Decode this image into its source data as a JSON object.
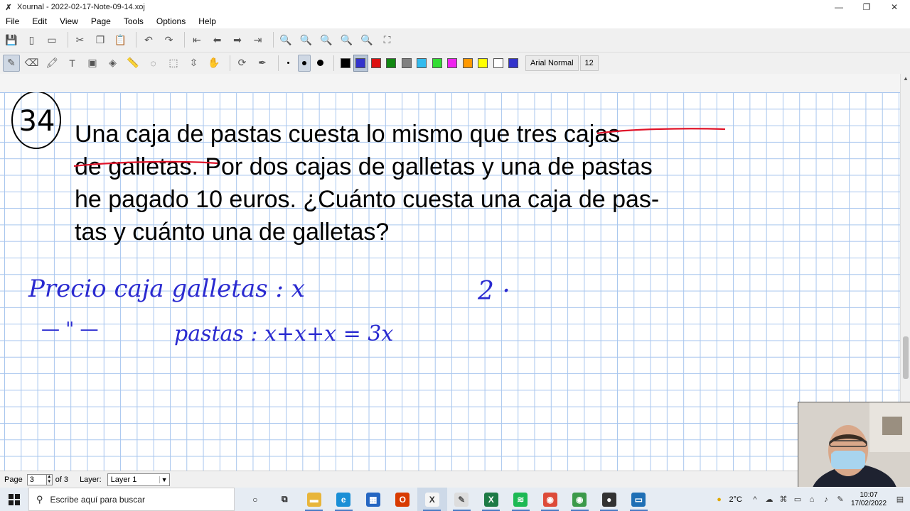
{
  "window": {
    "title": "Xournal - 2022-02-17-Note-09-14.xoj"
  },
  "menu": [
    "File",
    "Edit",
    "View",
    "Page",
    "Tools",
    "Options",
    "Help"
  ],
  "toolbar_main": [
    {
      "name": "save-icon",
      "glyph": "💾"
    },
    {
      "name": "new-page-icon",
      "glyph": "▯"
    },
    {
      "name": "open-icon",
      "glyph": "▭"
    },
    {
      "name": "cut-icon",
      "glyph": "✂"
    },
    {
      "name": "copy-icon",
      "glyph": "❐"
    },
    {
      "name": "paste-icon",
      "glyph": "📋"
    },
    {
      "name": "undo-icon",
      "glyph": "↶"
    },
    {
      "name": "redo-icon",
      "glyph": "↷"
    },
    {
      "name": "first-page-icon",
      "glyph": "⇤"
    },
    {
      "name": "previous-page-icon",
      "glyph": "⬅"
    },
    {
      "name": "next-page-icon",
      "glyph": "➡"
    },
    {
      "name": "last-page-icon",
      "glyph": "⇥"
    },
    {
      "name": "zoom-out-icon",
      "glyph": "🔍"
    },
    {
      "name": "zoom-normal-icon",
      "glyph": "🔍"
    },
    {
      "name": "zoom-in-icon",
      "glyph": "🔍"
    },
    {
      "name": "zoom-page-width-icon",
      "glyph": "🔍"
    },
    {
      "name": "zoom-set-icon",
      "glyph": "🔍"
    },
    {
      "name": "fullscreen-icon",
      "glyph": "⛶"
    }
  ],
  "toolbar_tools": [
    {
      "name": "pen-icon",
      "glyph": "✎",
      "active": true
    },
    {
      "name": "eraser-icon",
      "glyph": "⌫"
    },
    {
      "name": "highlighter-icon",
      "glyph": "🖍"
    },
    {
      "name": "text-icon",
      "glyph": "T"
    },
    {
      "name": "insert-image-icon",
      "glyph": "▣"
    },
    {
      "name": "shape-recognizer-icon",
      "glyph": "◈"
    },
    {
      "name": "ruler-icon",
      "glyph": "📏"
    },
    {
      "name": "select-region-icon",
      "glyph": "◌"
    },
    {
      "name": "select-rectangle-icon",
      "glyph": "⬚"
    },
    {
      "name": "vertical-space-icon",
      "glyph": "⇳"
    },
    {
      "name": "hand-icon",
      "glyph": "✋"
    },
    {
      "name": "default-tools-icon",
      "glyph": "⟳"
    },
    {
      "name": "default-pen-icon",
      "glyph": "✒"
    }
  ],
  "pen_sizes": [
    "fine-dot-icon",
    "medium-dot-icon",
    "thick-dot-icon"
  ],
  "palette": [
    {
      "name": "color-black",
      "color": "#000000"
    },
    {
      "name": "color-blue",
      "color": "#3333cc",
      "active": true
    },
    {
      "name": "color-red",
      "color": "#dd1111"
    },
    {
      "name": "color-green",
      "color": "#118811"
    },
    {
      "name": "color-gray",
      "color": "#808080"
    },
    {
      "name": "color-light-blue",
      "color": "#33bbee"
    },
    {
      "name": "color-light-green",
      "color": "#33dd33"
    },
    {
      "name": "color-magenta",
      "color": "#ee22ee"
    },
    {
      "name": "color-orange",
      "color": "#ff9900"
    },
    {
      "name": "color-yellow",
      "color": "#ffff00"
    },
    {
      "name": "color-white",
      "color": "#ffffff"
    },
    {
      "name": "color-custom-blue",
      "color": "#3333cc"
    }
  ],
  "font": {
    "name": "Arial Normal",
    "size": "12"
  },
  "problem": {
    "number": "34",
    "lines": [
      "Una caja de pastas cuesta lo mismo que tres cajas",
      "de galletas. Por dos cajas de galletas y una de pastas",
      "he pagado 10 euros. ¿Cuánto cuesta una caja de pas-",
      "tas y cuánto una de galletas?"
    ]
  },
  "handwriting": {
    "line1": "Precio caja galletas : x",
    "line2_ditto": "—  \"  —",
    "line2": "pastas : x+x+x  = 3x",
    "side": "2 ·",
    "ink_color": "#2a2ad0",
    "underline_color": "#e0142a"
  },
  "status": {
    "page_label": "Page",
    "page_value": "3",
    "page_of": "of 3",
    "layer_label": "Layer:",
    "layer_value": "Layer 1"
  },
  "taskbar": {
    "search_placeholder": "Escribe aquí para buscar",
    "apps": [
      {
        "name": "cortana-icon",
        "glyph": "○",
        "bg": "transparent",
        "fg": "#222"
      },
      {
        "name": "task-view-icon",
        "glyph": "⧉",
        "bg": "transparent",
        "fg": "#222"
      },
      {
        "name": "file-explorer-icon",
        "glyph": "▬",
        "bg": "#e8b53a",
        "fg": "#fff"
      },
      {
        "name": "edge-icon",
        "glyph": "e",
        "bg": "#1a8fd6",
        "fg": "#fff"
      },
      {
        "name": "store-icon",
        "glyph": "▦",
        "bg": "#2566c2",
        "fg": "#fff"
      },
      {
        "name": "office-icon",
        "glyph": "O",
        "bg": "#d83b01",
        "fg": "#fff"
      },
      {
        "name": "xournal-icon",
        "glyph": "X",
        "bg": "#f5f5f5",
        "fg": "#333",
        "active": true
      },
      {
        "name": "paint-icon",
        "glyph": "✎",
        "bg": "#ddd",
        "fg": "#555"
      },
      {
        "name": "excel-icon",
        "glyph": "X",
        "bg": "#1d7a45",
        "fg": "#fff"
      },
      {
        "name": "spotify-icon",
        "glyph": "≋",
        "bg": "#1db954",
        "fg": "#fff"
      },
      {
        "name": "chrome-icon",
        "glyph": "◉",
        "bg": "#dd4b39",
        "fg": "#fff"
      },
      {
        "name": "chrome-profile-icon",
        "glyph": "◉",
        "bg": "#3c9a4a",
        "fg": "#fff"
      },
      {
        "name": "obs-icon",
        "glyph": "●",
        "bg": "#333",
        "fg": "#fff"
      },
      {
        "name": "remote-desktop-icon",
        "glyph": "▭",
        "bg": "#1f6fb5",
        "fg": "#fff"
      }
    ],
    "weather": "2°C",
    "time": "10:07",
    "date": "17/02/2022"
  }
}
